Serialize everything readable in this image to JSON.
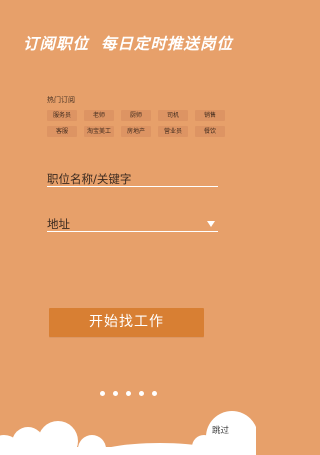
{
  "header": {
    "part1": "订阅职位",
    "part2": "每日定时推送岗位"
  },
  "hot": {
    "label": "热门订阅",
    "tags": [
      "服务员",
      "老师",
      "厨师",
      "司机",
      "销售",
      "客服",
      "淘宝美工",
      "房地产",
      "营业员",
      "餐饮"
    ]
  },
  "form": {
    "keyword_placeholder": "职位名称/关键字",
    "address_placeholder": "地址"
  },
  "actions": {
    "start_label": "开始找工作",
    "skip_label": "跳过"
  },
  "pager": {
    "total": 5
  },
  "colors": {
    "background": "#e7a06a",
    "button": "#d87f33",
    "tag": "#dd9463"
  }
}
